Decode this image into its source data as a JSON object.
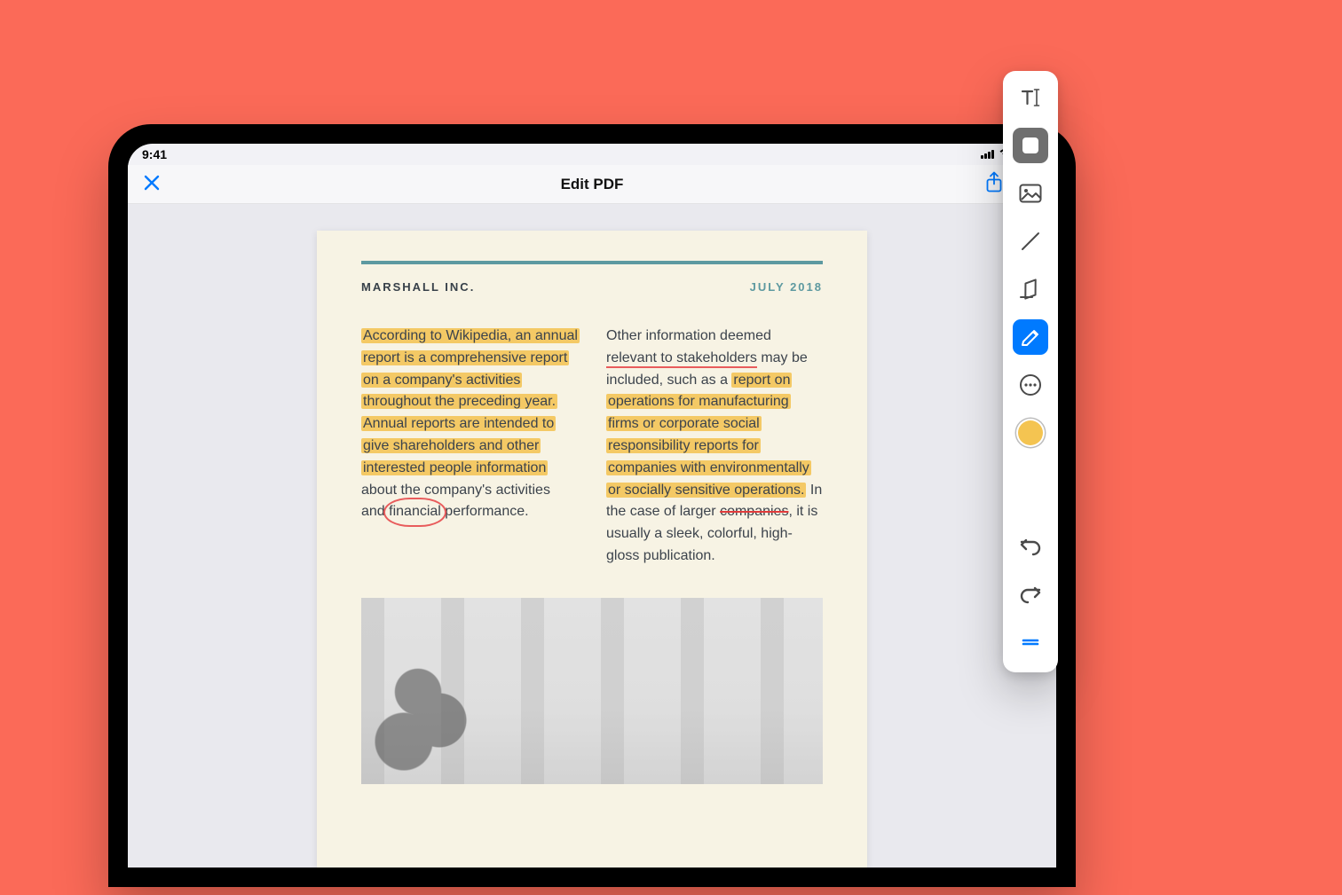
{
  "statusbar": {
    "time": "9:41"
  },
  "nav": {
    "title": "Edit PDF"
  },
  "document": {
    "company": "MARSHALL INC.",
    "date": "JULY 2018",
    "col1": {
      "hl1": "According to Wikipedia, an annual report is a comprehensive report on a company's activities throughout the preceding year. Annual reports are intended to give shareholders and other interested people information",
      "plain1": " about the company's activities and ",
      "circled": "financial",
      "plain2": " performance."
    },
    "col2": {
      "plain1": "Other information deemed ",
      "underlined": "relevant to stakeholders",
      "plain2": " may be included, such as a ",
      "hl1": "report on operations for manufacturing firms or corporate social responsibility reports for companies with environmentally or socially sensitive operations.",
      "plain3": " In the case of larger ",
      "strike": "companies",
      "plain4": ", it is usually a sleek, colorful, high-gloss publication."
    }
  },
  "tools": {
    "text": "text-tool",
    "textbox": "textbox-tool",
    "image": "image-tool",
    "line": "line-tool",
    "eraser": "eraser-tool",
    "highlighter": "highlighter-tool",
    "more": "more-tool",
    "color": "#f4c451",
    "undo": "undo",
    "redo": "redo",
    "grab": "grab-handle"
  }
}
